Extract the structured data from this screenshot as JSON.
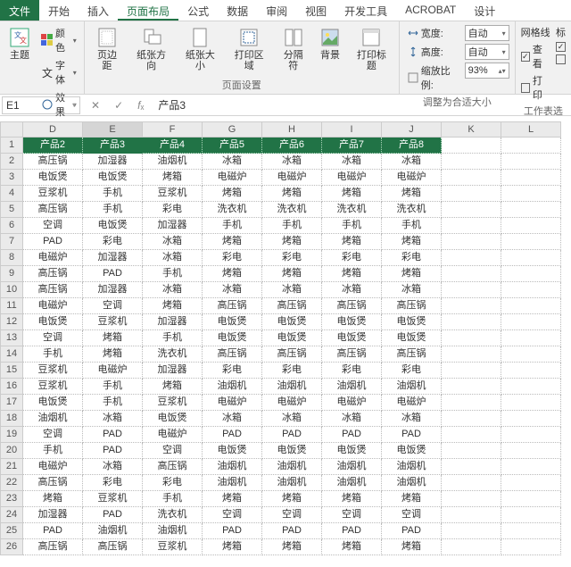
{
  "tabs": {
    "file": "文件",
    "list": [
      "开始",
      "插入",
      "页面布局",
      "公式",
      "数据",
      "审阅",
      "视图",
      "开发工具",
      "ACROBAT",
      "设计"
    ],
    "active": 2
  },
  "ribbon": {
    "g1": {
      "label": "主题",
      "theme": "主题",
      "colors": "颜色",
      "fonts": "字体",
      "effects": "效果"
    },
    "g2": {
      "label": "页面设置",
      "margins": "页边距",
      "orient": "纸张方向",
      "size": "纸张大小",
      "area": "打印区域",
      "breaks": "分隔符",
      "bg": "背景",
      "titles": "打印标题"
    },
    "g3": {
      "label": "调整为合适大小",
      "width": "宽度:",
      "height": "高度:",
      "scale": "缩放比例:",
      "auto": "自动",
      "scale_val": "93%"
    },
    "g4": {
      "label": "工作表选",
      "grid": "网格线",
      "view": "查看",
      "print": "打印"
    }
  },
  "namebox": {
    "ref": "E1",
    "fx_val": "产品3"
  },
  "colhdrs": [
    "D",
    "E",
    "F",
    "G",
    "H",
    "I",
    "J",
    "K",
    "L"
  ],
  "headers": [
    "产品2",
    "产品3",
    "产品4",
    "产品5",
    "产品6",
    "产品7",
    "产品8"
  ],
  "chart_data": {
    "type": "table",
    "columns": [
      "产品2",
      "产品3",
      "产品4",
      "产品5",
      "产品6",
      "产品7",
      "产品8"
    ],
    "rows": [
      [
        "高压锅",
        "加湿器",
        "油烟机",
        "冰箱",
        "冰箱",
        "冰箱",
        "冰箱"
      ],
      [
        "电饭煲",
        "电饭煲",
        "烤箱",
        "电磁炉",
        "电磁炉",
        "电磁炉",
        "电磁炉"
      ],
      [
        "豆浆机",
        "手机",
        "豆浆机",
        "烤箱",
        "烤箱",
        "烤箱",
        "烤箱"
      ],
      [
        "高压锅",
        "手机",
        "彩电",
        "洗衣机",
        "洗衣机",
        "洗衣机",
        "洗衣机"
      ],
      [
        "空调",
        "电饭煲",
        "加湿器",
        "手机",
        "手机",
        "手机",
        "手机"
      ],
      [
        "PAD",
        "彩电",
        "冰箱",
        "烤箱",
        "烤箱",
        "烤箱",
        "烤箱"
      ],
      [
        "电磁炉",
        "加湿器",
        "冰箱",
        "彩电",
        "彩电",
        "彩电",
        "彩电"
      ],
      [
        "高压锅",
        "PAD",
        "手机",
        "烤箱",
        "烤箱",
        "烤箱",
        "烤箱"
      ],
      [
        "高压锅",
        "加湿器",
        "冰箱",
        "冰箱",
        "冰箱",
        "冰箱",
        "冰箱"
      ],
      [
        "电磁炉",
        "空调",
        "烤箱",
        "高压锅",
        "高压锅",
        "高压锅",
        "高压锅"
      ],
      [
        "电饭煲",
        "豆浆机",
        "加湿器",
        "电饭煲",
        "电饭煲",
        "电饭煲",
        "电饭煲"
      ],
      [
        "空调",
        "烤箱",
        "手机",
        "电饭煲",
        "电饭煲",
        "电饭煲",
        "电饭煲"
      ],
      [
        "手机",
        "烤箱",
        "洗衣机",
        "高压锅",
        "高压锅",
        "高压锅",
        "高压锅"
      ],
      [
        "豆浆机",
        "电磁炉",
        "加湿器",
        "彩电",
        "彩电",
        "彩电",
        "彩电"
      ],
      [
        "豆浆机",
        "手机",
        "烤箱",
        "油烟机",
        "油烟机",
        "油烟机",
        "油烟机"
      ],
      [
        "电饭煲",
        "手机",
        "豆浆机",
        "电磁炉",
        "电磁炉",
        "电磁炉",
        "电磁炉"
      ],
      [
        "油烟机",
        "冰箱",
        "电饭煲",
        "冰箱",
        "冰箱",
        "冰箱",
        "冰箱"
      ],
      [
        "空调",
        "PAD",
        "电磁炉",
        "PAD",
        "PAD",
        "PAD",
        "PAD"
      ],
      [
        "手机",
        "PAD",
        "空调",
        "电饭煲",
        "电饭煲",
        "电饭煲",
        "电饭煲"
      ],
      [
        "电磁炉",
        "冰箱",
        "高压锅",
        "油烟机",
        "油烟机",
        "油烟机",
        "油烟机"
      ],
      [
        "高压锅",
        "彩电",
        "彩电",
        "油烟机",
        "油烟机",
        "油烟机",
        "油烟机"
      ],
      [
        "烤箱",
        "豆浆机",
        "手机",
        "烤箱",
        "烤箱",
        "烤箱",
        "烤箱"
      ],
      [
        "加湿器",
        "PAD",
        "洗衣机",
        "空调",
        "空调",
        "空调",
        "空调"
      ],
      [
        "PAD",
        "油烟机",
        "油烟机",
        "PAD",
        "PAD",
        "PAD",
        "PAD"
      ],
      [
        "高压锅",
        "高压锅",
        "豆浆机",
        "烤箱",
        "烤箱",
        "烤箱",
        "烤箱"
      ]
    ]
  }
}
